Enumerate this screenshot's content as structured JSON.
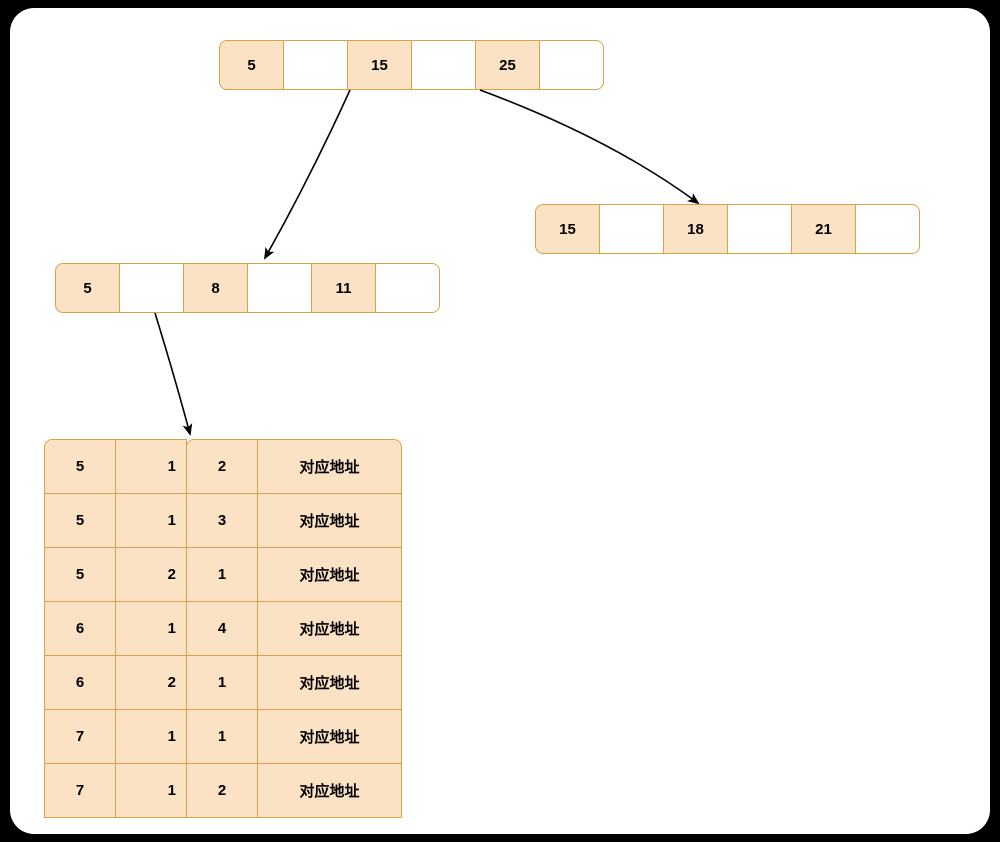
{
  "colors": {
    "key_fill": "#fce2c4",
    "ptr_fill": "#ffffff",
    "border": "#d9a24a",
    "bg": "#ffffff",
    "frame": "#000000"
  },
  "root_node": {
    "slots": [
      {
        "kind": "key",
        "v": "5"
      },
      {
        "kind": "ptr",
        "v": ""
      },
      {
        "kind": "key",
        "v": "15"
      },
      {
        "kind": "ptr",
        "v": ""
      },
      {
        "kind": "key",
        "v": "25"
      },
      {
        "kind": "ptr",
        "v": ""
      }
    ]
  },
  "right_node": {
    "slots": [
      {
        "kind": "key",
        "v": "15"
      },
      {
        "kind": "ptr",
        "v": ""
      },
      {
        "kind": "key",
        "v": "18"
      },
      {
        "kind": "ptr",
        "v": ""
      },
      {
        "kind": "key",
        "v": "21"
      },
      {
        "kind": "ptr",
        "v": ""
      }
    ]
  },
  "left_node": {
    "slots": [
      {
        "kind": "key",
        "v": "5"
      },
      {
        "kind": "ptr",
        "v": ""
      },
      {
        "kind": "key",
        "v": "8"
      },
      {
        "kind": "ptr",
        "v": ""
      },
      {
        "kind": "key",
        "v": "11"
      },
      {
        "kind": "ptr",
        "v": ""
      }
    ]
  },
  "table": {
    "rows": [
      {
        "c0": "5",
        "c1": "1",
        "c2": "2",
        "c3": "对应地址"
      },
      {
        "c0": "5",
        "c1": "1",
        "c2": "3",
        "c3": "对应地址"
      },
      {
        "c0": "5",
        "c1": "2",
        "c2": "1",
        "c3": "对应地址"
      },
      {
        "c0": "6",
        "c1": "1",
        "c2": "4",
        "c3": "对应地址"
      },
      {
        "c0": "6",
        "c1": "2",
        "c2": "1",
        "c3": "对应地址"
      },
      {
        "c0": "7",
        "c1": "1",
        "c2": "1",
        "c3": "对应地址"
      },
      {
        "c0": "7",
        "c1": "1",
        "c2": "2",
        "c3": "对应地址"
      }
    ]
  }
}
